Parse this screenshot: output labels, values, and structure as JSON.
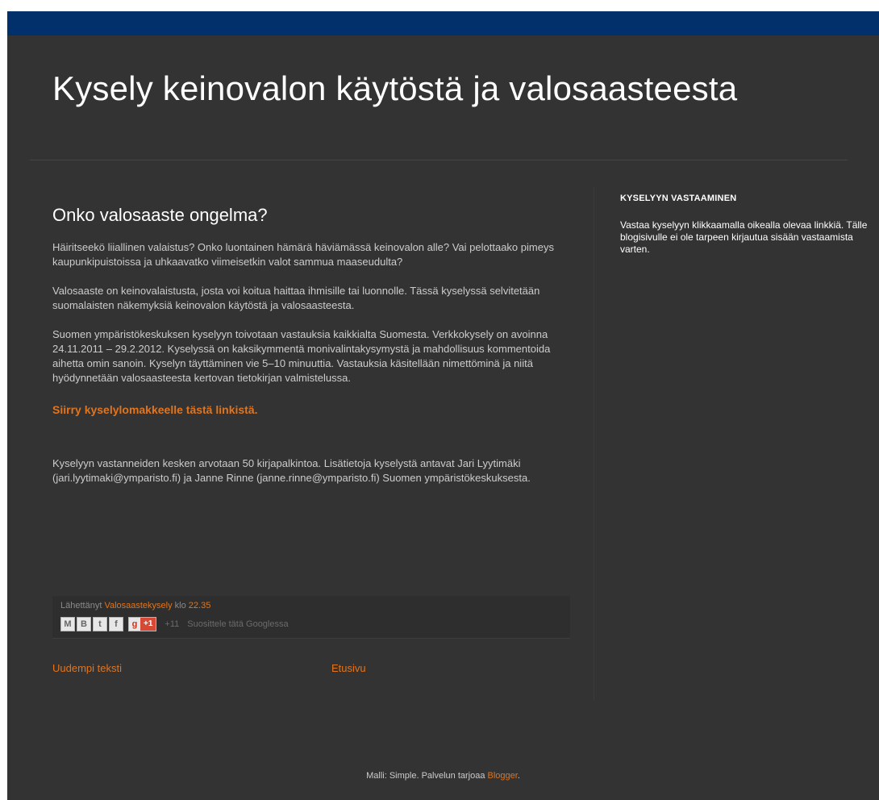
{
  "header": {
    "title": "Kysely keinovalon käytöstä ja valosaasteesta"
  },
  "post": {
    "title": "Onko valosaaste ongelma?",
    "paragraphs": [
      "Häiritseekö liiallinen valaistus? Onko luontainen hämärä häviämässä keinovalon alle? Vai pelottaako pimeys kaupunkipuistoissa ja uhkaavatko viimeisetkin valot sammua maaseudulta?",
      "Valosaaste on keinovalaistusta, josta voi koitua haittaa ihmisille tai luonnolle. Tässä kyselyssä selvitetään suomalaisten näkemyksiä keinovalon käytöstä ja valosaasteesta.",
      "Suomen ympäristökeskuksen kyselyyn toivotaan vastauksia kaikkialta Suomesta. Verkkokysely on avoinna 24.11.2011 – 29.2.2012. Kyselyssä on kaksikymmentä monivalintakysymystä ja mahdollisuus kommentoida aihetta omin sanoin. Kyselyn täyttäminen vie 5–10 minuuttia. Vastauksia käsitellään nimettöminä ja niitä hyödynnetään valosaasteesta kertovan tietokirjan valmistelussa."
    ],
    "survey_link": "Siirry kyselylomakkeelle tästä linkistä.",
    "closing_paragraph": "Kyselyyn vastanneiden kesken arvotaan 50 kirjapalkintoa. Lisätietoja kyselystä antavat Jari Lyytimäki (jari.lyytimaki@ymparisto.fi) ja Janne Rinne (janne.rinne@ymparisto.fi) Suomen ympäristökeskuksesta."
  },
  "post_footer": {
    "posted_by_prefix": "Lähettänyt ",
    "author": "Valosaastekysely",
    "time_prefix": " klo ",
    "time": "22.35",
    "share_buttons": [
      {
        "icon": "email-icon",
        "glyph": "M"
      },
      {
        "icon": "blogthis-icon",
        "glyph": "B"
      },
      {
        "icon": "twitter-icon",
        "glyph": "t"
      },
      {
        "icon": "facebook-icon",
        "glyph": "f"
      }
    ],
    "gplus_glyph": "g",
    "gplus_label": "+1",
    "gplus_count": "+11",
    "gplus_recommend": "Suosittele tätä Googlessa"
  },
  "nav": {
    "newer": "Uudempi teksti",
    "home": "Etusivu"
  },
  "sidebar": {
    "heading": "KYSELYYN VASTAAMINEN",
    "text": "Vastaa kyselyyn klikkaamalla oikealla olevaa linkkiä. Tälle blogisivulle ei ole tarpeen kirjautua sisään vastaamista varten."
  },
  "attribution": {
    "prefix": "Malli: Simple. Palvelun tarjoaa ",
    "link": "Blogger",
    "suffix": "."
  },
  "colors": {
    "top_bar": "#02306a",
    "background": "#333333",
    "link": "#e2741b"
  }
}
